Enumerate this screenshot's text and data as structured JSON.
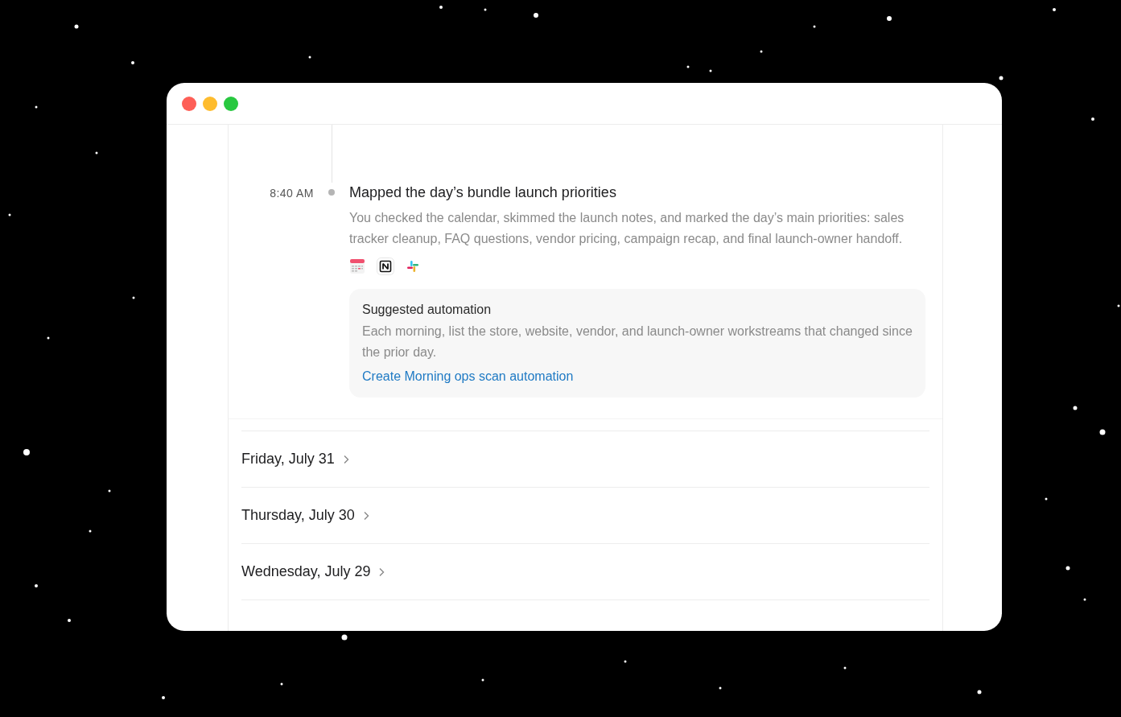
{
  "entry": {
    "time": "8:40 AM",
    "title": "Mapped the day’s bundle launch priorities",
    "description": "You checked the calendar, skimmed the launch notes, and marked the day’s main priorities: sales tracker cleanup, FAQ questions, vendor pricing, campaign recap, and final launch-owner handoff.",
    "apps": [
      {
        "kind": "calendar"
      },
      {
        "kind": "notebook"
      },
      {
        "kind": "chat"
      }
    ],
    "automation": {
      "heading": "Suggested automation",
      "text": "Each morning, list the store, website, vendor, and launch-owner workstreams that changed since the prior day.",
      "link": "Create Morning ops scan automation"
    }
  },
  "days": [
    {
      "label": "Friday, July 31"
    },
    {
      "label": "Thursday, July 30"
    },
    {
      "label": "Wednesday, July 29"
    }
  ]
}
